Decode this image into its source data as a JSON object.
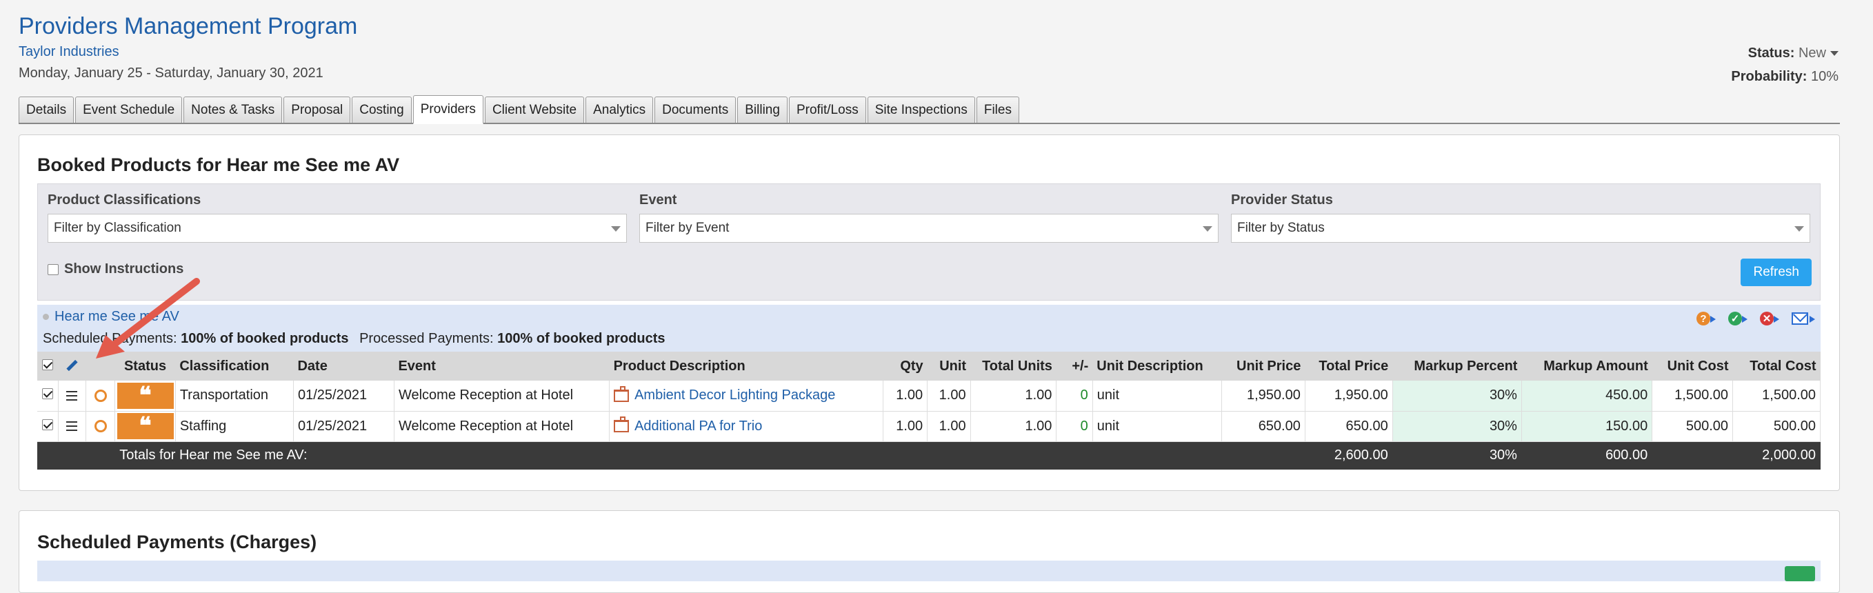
{
  "header": {
    "title": "Providers Management Program",
    "company": "Taylor Industries",
    "dates": "Monday, January 25 - Saturday, January 30, 2021",
    "status_label": "Status:",
    "status_value": "New",
    "probability_label": "Probability:",
    "probability_value": "10%"
  },
  "tabs": [
    "Details",
    "Event Schedule",
    "Notes & Tasks",
    "Proposal",
    "Costing",
    "Providers",
    "Client Website",
    "Analytics",
    "Documents",
    "Billing",
    "Profit/Loss",
    "Site Inspections",
    "Files"
  ],
  "active_tab": "Providers",
  "panel": {
    "title": "Booked Products for Hear me See me AV",
    "filters": {
      "classification_label": "Product Classifications",
      "classification_value": "Filter by Classification",
      "event_label": "Event",
      "event_value": "Filter by Event",
      "provider_status_label": "Provider Status",
      "provider_status_value": "Filter by Status",
      "show_instructions": "Show Instructions",
      "refresh": "Refresh"
    },
    "provider": {
      "name": "Hear me See me AV",
      "scheduled_label": "Scheduled Payments:",
      "scheduled_value": "100% of booked products",
      "processed_label": "Processed Payments:",
      "processed_value": "100% of booked products"
    },
    "columns": [
      "Status",
      "Classification",
      "Date",
      "Event",
      "Product Description",
      "Qty",
      "Unit",
      "Total Units",
      "+/-",
      "Unit Description",
      "Unit Price",
      "Total Price",
      "Markup Percent",
      "Markup Amount",
      "Unit Cost",
      "Total Cost"
    ],
    "rows": [
      {
        "classification": "Transportation",
        "date": "01/25/2021",
        "event": "Welcome Reception at Hotel",
        "product": "Ambient Decor Lighting Package",
        "qty": "1.00",
        "unit": "1.00",
        "total_units": "1.00",
        "adj": "0",
        "unit_desc": "unit",
        "unit_price": "1,950.00",
        "total_price": "1,950.00",
        "markup_pct": "30%",
        "markup_amt": "450.00",
        "unit_cost": "1,500.00",
        "total_cost": "1,500.00"
      },
      {
        "classification": "Staffing",
        "date": "01/25/2021",
        "event": "Welcome Reception at Hotel",
        "product": "Additional PA for Trio",
        "qty": "1.00",
        "unit": "1.00",
        "total_units": "1.00",
        "adj": "0",
        "unit_desc": "unit",
        "unit_price": "650.00",
        "total_price": "650.00",
        "markup_pct": "30%",
        "markup_amt": "150.00",
        "unit_cost": "500.00",
        "total_cost": "500.00"
      }
    ],
    "totals": {
      "label": "Totals for Hear me See me AV:",
      "total_price": "2,600.00",
      "markup_pct": "30%",
      "markup_amt": "600.00",
      "total_cost": "2,000.00"
    }
  },
  "panel2": {
    "title": "Scheduled Payments (Charges)"
  },
  "colors": {
    "brand_blue": "#1f5fa8",
    "refresh": "#2aa3ef",
    "status_orange": "#e8892d",
    "markup_green_bg": "#e2f5ec",
    "annotation_arrow": "#e25a4c"
  },
  "icons": [
    "pencil-icon",
    "menu-icon",
    "status-ring-icon",
    "quote-icon",
    "product-icon",
    "help-icon",
    "confirm-icon",
    "cancel-icon",
    "email-icon"
  ]
}
